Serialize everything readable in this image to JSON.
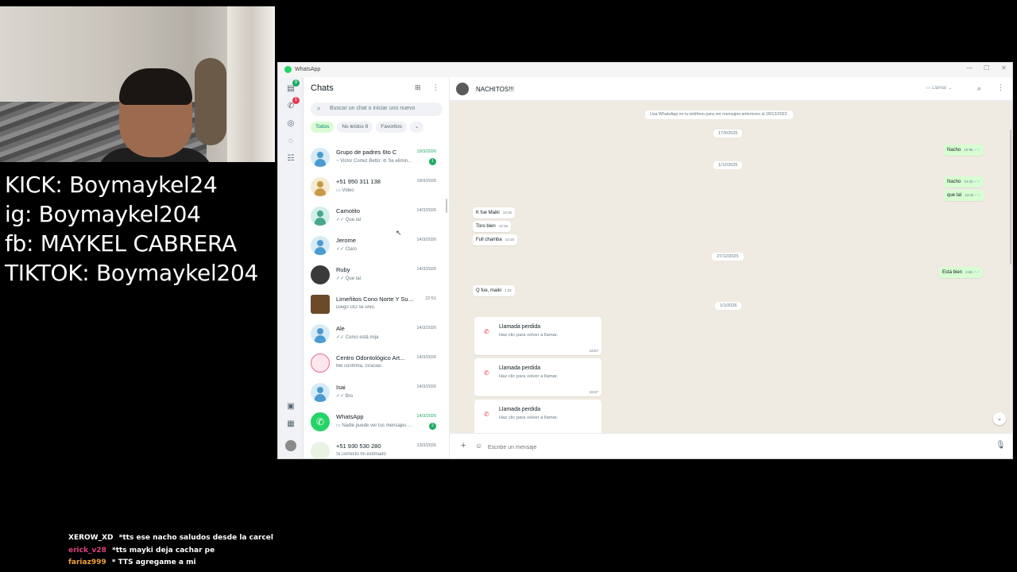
{
  "social": {
    "kick": "KICK: Boymaykel24",
    "ig": "ig: Boymaykel204",
    "fb": "fb: MAYKEL CABRERA",
    "tiktok": "TIKTOK: Boymaykel204"
  },
  "stream_chat": [
    {
      "user": "XEROW_XD",
      "message": "*tts ese nacho saludos desde la carcel",
      "color": "#ffffff"
    },
    {
      "user": "erick_v28",
      "message": "*tts mayki deja cachar pe",
      "color": "#e0417f"
    },
    {
      "user": "fariaz999",
      "message": "* TTS agregame a mi",
      "color": "#f0a13a"
    }
  ],
  "window": {
    "title": "WhatsApp"
  },
  "rail": {
    "chats_badge": "9",
    "calls_badge": "1"
  },
  "chat_list": {
    "header": "Chats",
    "search_placeholder": "Buscar un chat o iniciar uno nuevo",
    "filters": [
      "Todos",
      "No leídos 8",
      "Favoritos",
      "⌄"
    ],
    "chats": [
      {
        "name": "Grupo de padres 6to C",
        "preview": "~ Victor Cortez Betto: ⊘ Se elimin...",
        "time": "19/3/2026",
        "badge": "1"
      },
      {
        "name": "+51 950 311 138",
        "preview": "▭ Video",
        "time": "19/3/2026",
        "badge": ""
      },
      {
        "name": "Camotito",
        "preview": "✓✓ Que tal",
        "time": "14/3/2026",
        "badge": ""
      },
      {
        "name": "Jerome",
        "preview": "✓✓ Claro",
        "time": "14/3/2026",
        "badge": ""
      },
      {
        "name": "Ruby",
        "preview": "✓✓ Que tal",
        "time": "14/3/2026",
        "badge": ""
      },
      {
        "name": "Limeñitos Cono Norte Y Sur ...",
        "preview": "Diego GO se unió.",
        "time": "22:51",
        "badge": ""
      },
      {
        "name": "Ale",
        "preview": "✓✓ Como está mija",
        "time": "14/3/2026",
        "badge": ""
      },
      {
        "name": "Centro Odontológico Art...",
        "preview": "Me confirma, Gracias",
        "time": "14/3/2026",
        "badge": ""
      },
      {
        "name": "Isai",
        "preview": "✓✓ Bro",
        "time": "14/3/2026",
        "badge": ""
      },
      {
        "name": "WhatsApp",
        "preview": "▭ Nadie puede ver tus mensajes ...",
        "time": "14/3/2026",
        "badge": "2"
      },
      {
        "name": "+51 930 530 280",
        "preview": "Si correcto mi estimado",
        "time": "13/3/2026",
        "badge": ""
      }
    ]
  },
  "conversation": {
    "name": "NACHITOS!!!",
    "call_label": "Llamar",
    "system_message": "Usa WhatsApp en tu teléfono para ver mensajes anteriores al 28/12/2022.",
    "dates": [
      "17/9/2025",
      "1/12/2025",
      "27/12/2025",
      "1/1/2026"
    ],
    "messages": [
      {
        "text": "Nacho",
        "time": "15:56",
        "dir": "out"
      },
      {
        "text": "Nacho",
        "time": "13:32",
        "dir": "out"
      },
      {
        "text": "que tal",
        "time": "13:32",
        "dir": "out"
      },
      {
        "text": "K fue Maiki",
        "time": "14:16",
        "dir": "in"
      },
      {
        "text": "Toro bien",
        "time": "14:16",
        "dir": "in"
      },
      {
        "text": "Full chamba",
        "time": "14:16",
        "dir": "in"
      },
      {
        "text": "Está bien",
        "time": "2:48",
        "dir": "out"
      },
      {
        "text": "Q fue, maiki",
        "time": "1:32",
        "dir": "in"
      }
    ],
    "missed_calls": [
      {
        "title": "Llamada perdida",
        "subtitle": "Haz clic para volver a llamar.",
        "time": "19:57"
      },
      {
        "title": "Llamada perdida",
        "subtitle": "Haz clic para volver a llamar.",
        "time": "19:57"
      },
      {
        "title": "Llamada perdida",
        "subtitle": "Haz clic para volver a llamar.",
        "time": ""
      }
    ],
    "composer_placeholder": "Escribe un mensaje"
  },
  "colors": {
    "accent": "#25d366",
    "unread_green": "#1daa61",
    "outgoing_bubble": "#d9fdd3",
    "chat_background": "#efeae2",
    "missed_call_red": "#e53950",
    "read_ticks": "#53bdeb"
  },
  "icons": {
    "rail": [
      "chats-icon",
      "calls-icon",
      "status-icon",
      "channels-icon",
      "communities-icon",
      "media-icon",
      "archive-icon",
      "profile-avatar"
    ],
    "header": [
      "new-chat-icon",
      "menu-icon",
      "video-call-icon",
      "search-icon"
    ],
    "composer": [
      "plus-icon",
      "emoji-icon",
      "mic-icon"
    ]
  }
}
